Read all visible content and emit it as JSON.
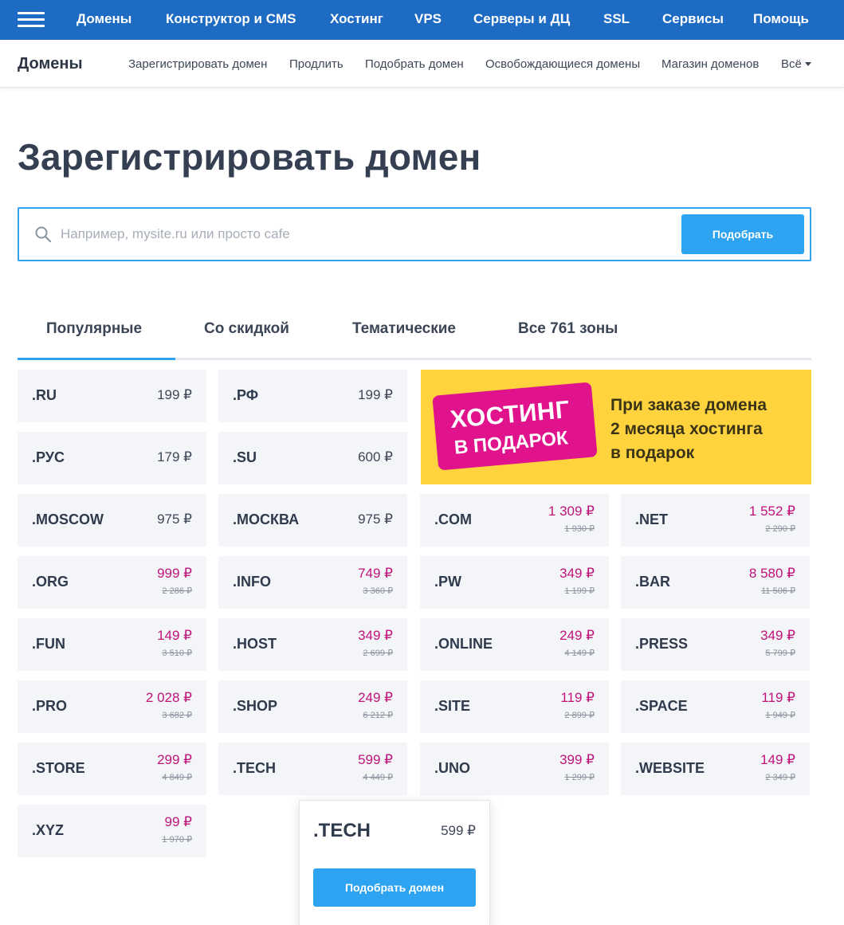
{
  "topnav": {
    "items": [
      "Домены",
      "Конструктор и CMS",
      "Хостинг",
      "VPS",
      "Серверы и ДЦ",
      "SSL",
      "Сервисы",
      "Помощь"
    ]
  },
  "subnav": {
    "brand": "Домены",
    "links": [
      "Зарегистрировать домен",
      "Продлить",
      "Подобрать домен",
      "Освобождающиеся домены",
      "Магазин доменов",
      "Всё"
    ]
  },
  "page_title": "Зарегистрировать домен",
  "search": {
    "placeholder": "Например, mysite.ru или просто cafe",
    "button_label": "Подобрать"
  },
  "tabs": [
    "Популярные",
    "Со скидкой",
    "Тематические",
    "Все 761 зоны"
  ],
  "active_tab": 0,
  "domains": [
    {
      "zone": ".RU",
      "price": "199 ₽"
    },
    {
      "zone": ".РФ",
      "price": "199 ₽"
    },
    {
      "zone": ".РУС",
      "price": "179 ₽"
    },
    {
      "zone": ".SU",
      "price": "600 ₽"
    },
    {
      "zone": ".MOSCOW",
      "price": "975 ₽"
    },
    {
      "zone": ".МОСКВА",
      "price": "975 ₽"
    },
    {
      "zone": ".COM",
      "price": "1 309 ₽",
      "old": "1 930 ₽"
    },
    {
      "zone": ".NET",
      "price": "1 552 ₽",
      "old": "2 290 ₽"
    },
    {
      "zone": ".ORG",
      "price": "999 ₽",
      "old": "2 286 ₽"
    },
    {
      "zone": ".INFO",
      "price": "749 ₽",
      "old": "3 360 ₽"
    },
    {
      "zone": ".PW",
      "price": "349 ₽",
      "old": "1 199 ₽"
    },
    {
      "zone": ".BAR",
      "price": "8 580 ₽",
      "old": "11 506 ₽"
    },
    {
      "zone": ".FUN",
      "price": "149 ₽",
      "old": "3 510 ₽"
    },
    {
      "zone": ".HOST",
      "price": "349 ₽",
      "old": "2 699 ₽"
    },
    {
      "zone": ".ONLINE",
      "price": "249 ₽",
      "old": "4 149 ₽"
    },
    {
      "zone": ".PRESS",
      "price": "349 ₽",
      "old": "5 799 ₽"
    },
    {
      "zone": ".PRO",
      "price": "2 028 ₽",
      "old": "3 682 ₽"
    },
    {
      "zone": ".SHOP",
      "price": "249 ₽",
      "old": "6 212 ₽"
    },
    {
      "zone": ".SITE",
      "price": "119 ₽",
      "old": "2 899 ₽"
    },
    {
      "zone": ".SPACE",
      "price": "119 ₽",
      "old": "1 949 ₽"
    },
    {
      "zone": ".STORE",
      "price": "299 ₽",
      "old": "4 849 ₽"
    },
    {
      "zone": ".TECH",
      "price": "599 ₽",
      "old": "4 449 ₽"
    },
    {
      "zone": ".UNO",
      "price": "399 ₽",
      "old": "1 299 ₽"
    },
    {
      "zone": ".WEBSITE",
      "price": "149 ₽",
      "old": "2 349 ₽"
    },
    {
      "zone": ".XYZ",
      "price": "99 ₽",
      "old": "1 970 ₽"
    }
  ],
  "promo": {
    "badge_line1": "ХОСТИНГ",
    "badge_line2": "В ПОДАРОК",
    "text_lines": [
      "При заказе домена",
      "2 месяца хостинга",
      "в подарок"
    ],
    "bg_color": "#ffd33d",
    "badge_color": "#e0138c"
  },
  "popup": {
    "zone": ".TECH",
    "price": "599 ₽",
    "button_label": "Подобрать домен"
  },
  "colors": {
    "nav_bg": "#1e6bc4",
    "accent": "#2ea3f2",
    "sale_price": "#c0137a"
  }
}
